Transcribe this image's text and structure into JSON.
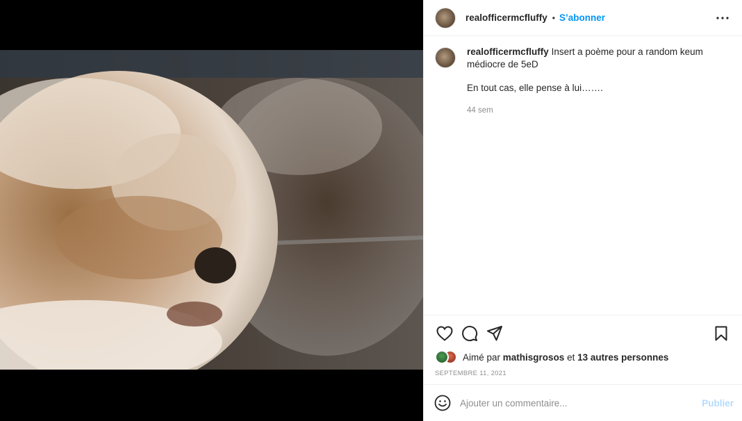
{
  "post": {
    "author": {
      "username": "realofficermcfluffy",
      "avatar_icon": "dog-avatar"
    },
    "header": {
      "separator": "•",
      "follow_label": "S’abonner",
      "more_icon": "more-options-icon"
    },
    "caption": {
      "username": "realofficermcfluffy",
      "text": "Insert a poème pour a random keum médiocre de 5eD",
      "second_paragraph": "En tout cas, elle pense à lui…….",
      "time_ago": "44 sem"
    },
    "actions": {
      "like_icon": "heart-icon",
      "comment_icon": "comment-icon",
      "share_icon": "send-icon",
      "save_icon": "bookmark-icon"
    },
    "likes": {
      "prefix": "Aimé par",
      "first_liker": "mathisgrosos",
      "conjunction": "et",
      "others": "13 autres personnes"
    },
    "date": "SEPTEMBRE 11, 2021",
    "comment_box": {
      "emoji_icon": "emoji-icon",
      "placeholder": "Ajouter un commentaire...",
      "publish_label": "Publier"
    },
    "colors": {
      "accent": "#0095f6",
      "publish_disabled": "#b3dbff",
      "muted": "#8e8e8e",
      "text": "#262626"
    }
  }
}
